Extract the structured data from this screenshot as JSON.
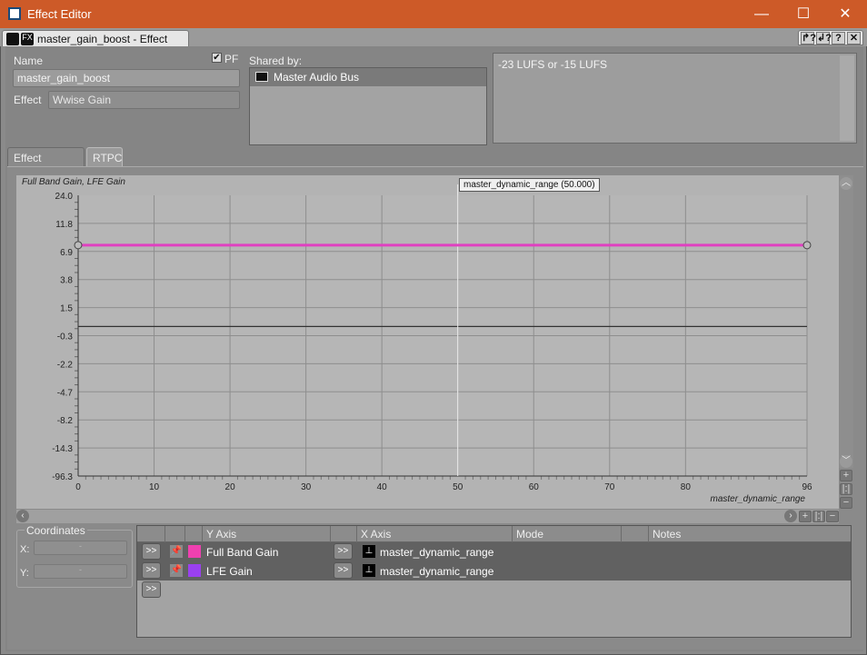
{
  "window": {
    "title": "Effect Editor",
    "minimize": "—",
    "maximize": "☐",
    "close": "✕"
  },
  "doc_tab": {
    "label": "master_gain_boost - Effect Editor",
    "buttons": [
      "↱?",
      "↲?",
      "?",
      "✕"
    ]
  },
  "form": {
    "name_label": "Name",
    "name_value": "master_gain_boost",
    "pf_label": "PF",
    "pf_checked": true,
    "effect_label": "Effect",
    "effect_value": "Wwise Gain",
    "shared_label": "Shared by:",
    "shared_items": [
      "Master Audio Bus"
    ],
    "notes": "-23 LUFS or -15 LUFS"
  },
  "tabs": [
    {
      "label": "Effect Settings",
      "active": false
    },
    {
      "label": "RTPC",
      "active": true
    }
  ],
  "chart_data": {
    "type": "line",
    "ylabel": "Full Band Gain, LFE Gain",
    "xlabel": "master_dynamic_range",
    "xlim": [
      0,
      96
    ],
    "x_ticks": [
      0,
      10,
      20,
      30,
      40,
      50,
      60,
      70,
      80,
      96
    ],
    "y_tick_labels": [
      "24.0",
      "11.8",
      "6.9",
      "3.8",
      "1.5",
      "-0.3",
      "-2.2",
      "-4.7",
      "-8.2",
      "-14.3",
      "-96.3"
    ],
    "cursor": {
      "x": 50,
      "label": "master_dynamic_range (50.000)"
    },
    "series": [
      {
        "name": "Full Band Gain",
        "color": "#e040c0",
        "points": [
          [
            0,
            8.0
          ],
          [
            96,
            8.0
          ]
        ]
      }
    ],
    "zero_line": 0,
    "grid": true
  },
  "coordinates": {
    "title": "Coordinates",
    "x_label": "X:",
    "x_value": "-",
    "y_label": "Y:",
    "y_value": "-"
  },
  "table": {
    "headers": {
      "y_axis": "Y Axis",
      "x_axis": "X Axis",
      "mode": "Mode",
      "notes": "Notes"
    },
    "expand_label": ">>",
    "rows": [
      {
        "y_axis": "Full Band Gain",
        "color": "#f040b0",
        "x_axis": "master_dynamic_range",
        "mode": "",
        "notes": ""
      },
      {
        "y_axis": "LFE Gain",
        "color": "#9a40f0",
        "x_axis": "master_dynamic_range",
        "mode": "",
        "notes": ""
      }
    ]
  }
}
